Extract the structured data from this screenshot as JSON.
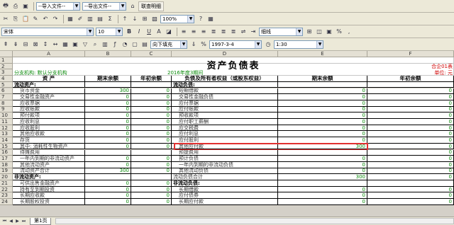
{
  "toolbar1": {
    "import_file": "--导入文件--",
    "export_file": "--导出文件--",
    "check_detail": "联查明细"
  },
  "toolbar2": {
    "zoom": "100%"
  },
  "toolbar3": {
    "font": "宋体",
    "size": "10",
    "border_style": "细线"
  },
  "toolbar4": {
    "fill_mode": "向下填充",
    "date": "1997-3-4",
    "time": "1:30"
  },
  "columns": [
    "A",
    "B",
    "C",
    "D",
    "E",
    "F"
  ],
  "title": "资产负债表",
  "org_line": "分支机构: 默认分支机构",
  "period": "2016年度3期间",
  "unit_label": "合企01表",
  "currency_label": "单位: 元",
  "headers": {
    "asset": "资    产",
    "end_balance": "期末余额",
    "begin_balance": "年初余额",
    "liab": "负债及所有者权益（或股东权益）"
  },
  "rows": [
    {
      "n": "5",
      "a": "流动资产:",
      "b": "",
      "c": "",
      "d": "流动负债:",
      "e": "",
      "f": "",
      "ab": true,
      "db": true
    },
    {
      "n": "6",
      "a": "货币资金",
      "b": "300",
      "c": "0",
      "d": "短期借款",
      "e": "0",
      "f": "0"
    },
    {
      "n": "7",
      "a": "交易性金融资产",
      "b": "0",
      "c": "0",
      "d": "交易性金融负债",
      "e": "0",
      "f": "0"
    },
    {
      "n": "8",
      "a": "应收票据",
      "b": "0",
      "c": "0",
      "d": "应付票据",
      "e": "0",
      "f": "0"
    },
    {
      "n": "9",
      "a": "应收账款",
      "b": "0",
      "c": "0",
      "d": "应付账款",
      "e": "0",
      "f": "0"
    },
    {
      "n": "10",
      "a": "预付款项",
      "b": "0",
      "c": "0",
      "d": "预收款项",
      "e": "0",
      "f": "0"
    },
    {
      "n": "11",
      "a": "应收利息",
      "b": "0",
      "c": "0",
      "d": "应付职工薪酬",
      "e": "0",
      "f": "0"
    },
    {
      "n": "12",
      "a": "应收股利",
      "b": "0",
      "c": "0",
      "d": "应交税费",
      "e": "0",
      "f": "0"
    },
    {
      "n": "13",
      "a": "其他应收款",
      "b": "0",
      "c": "0",
      "d": "应付利息",
      "e": "0",
      "f": "0"
    },
    {
      "n": "14",
      "a": "存货",
      "b": "0",
      "c": "0",
      "d": "应付股利",
      "e": "0",
      "f": "0"
    },
    {
      "n": "15",
      "a": "其中: 消耗性生物资产",
      "b": "0",
      "c": "0",
      "d": "其他应付款",
      "e": "300",
      "f": "0"
    },
    {
      "n": "16",
      "a": "待摊费用",
      "b": "",
      "c": "",
      "d": "预提费用",
      "e": "",
      "f": "0"
    },
    {
      "n": "17",
      "a": "一年内到期的非流动资产",
      "b": "0",
      "c": "0",
      "d": "预计负债",
      "e": "0",
      "f": "0"
    },
    {
      "n": "18",
      "a": "其他流动资产",
      "b": "0",
      "c": "0",
      "d": "一年内到期的非流动负债",
      "e": "0",
      "f": "0"
    },
    {
      "n": "19",
      "a": "流动资产合计",
      "b": "300",
      "c": "0",
      "d": "其他流动负债",
      "e": "0",
      "f": "0"
    },
    {
      "n": "20",
      "a": "非流动资产:",
      "b": "",
      "c": "",
      "d": "流动负债合计",
      "e": "300",
      "f": "0",
      "ab": true
    },
    {
      "n": "21",
      "a": "可供出售金融资产",
      "b": "0",
      "c": "0",
      "d": "非流动负债:",
      "e": "",
      "f": "",
      "db": true
    },
    {
      "n": "22",
      "a": "持有至到期投资",
      "b": "0",
      "c": "0",
      "d": "长期借款",
      "e": "0",
      "f": "0"
    },
    {
      "n": "23",
      "a": "长期应收款",
      "b": "0",
      "c": "0",
      "d": "应付债券",
      "e": "0",
      "f": "0"
    },
    {
      "n": "24",
      "a": "长期股权投资",
      "b": "0",
      "c": "0",
      "d": "长期应付款",
      "e": "0",
      "f": "0"
    }
  ],
  "sheet_tab": "第1页"
}
